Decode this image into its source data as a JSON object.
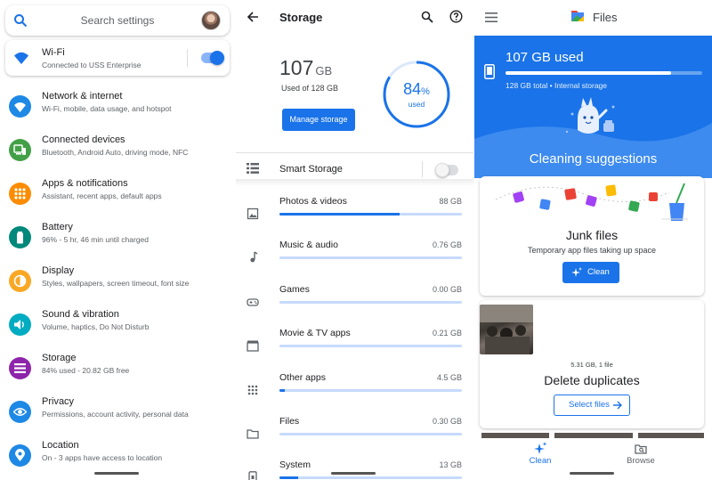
{
  "settings": {
    "search_placeholder": "Search settings",
    "wifi": {
      "title": "Wi-Fi",
      "subtitle": "Connected to USS Enterprise",
      "enabled": true
    },
    "items": [
      {
        "title": "Network & internet",
        "subtitle": "Wi-Fi, mobile, data usage, and hotspot",
        "icon": "wifi-icon",
        "color": "#1e88e5"
      },
      {
        "title": "Connected devices",
        "subtitle": "Bluetooth, Android Auto, driving mode, NFC",
        "icon": "devices-icon",
        "color": "#43a047"
      },
      {
        "title": "Apps & notifications",
        "subtitle": "Assistant, recent apps, default apps",
        "icon": "apps-icon",
        "color": "#fb8c00"
      },
      {
        "title": "Battery",
        "subtitle": "96% - 5 hr, 46 min until charged",
        "icon": "battery-icon",
        "color": "#00897b"
      },
      {
        "title": "Display",
        "subtitle": "Styles, wallpapers, screen timeout, font size",
        "icon": "display-icon",
        "color": "#f9a825"
      },
      {
        "title": "Sound & vibration",
        "subtitle": "Volume, haptics, Do Not Disturb",
        "icon": "volume-icon",
        "color": "#00acc1"
      },
      {
        "title": "Storage",
        "subtitle": "84% used - 20.82 GB free",
        "icon": "storage-icon",
        "color": "#8e24aa"
      },
      {
        "title": "Privacy",
        "subtitle": "Permissions, account activity, personal data",
        "icon": "eye-icon",
        "color": "#1e88e5"
      },
      {
        "title": "Location",
        "subtitle": "On - 3 apps have access to location",
        "icon": "location-icon",
        "color": "#1e88e5"
      }
    ]
  },
  "storage": {
    "title": "Storage",
    "used_value": "107",
    "used_unit": "GB",
    "used_of": "Used of 128 GB",
    "manage_label": "Manage storage",
    "percent_value": "84",
    "percent_sign": "%",
    "percent_fraction": 0.84,
    "used_label": "used",
    "smart_storage_label": "Smart Storage",
    "smart_storage_enabled": false,
    "categories": [
      {
        "label": "Photos & videos",
        "size": "88 GB",
        "fraction": 0.66,
        "icon": "photo-icon"
      },
      {
        "label": "Music & audio",
        "size": "0.76 GB",
        "fraction": 0.0,
        "icon": "music-icon"
      },
      {
        "label": "Games",
        "size": "0.00 GB",
        "fraction": 0.0,
        "icon": "gamepad-icon"
      },
      {
        "label": "Movie & TV apps",
        "size": "0.21 GB",
        "fraction": 0.0,
        "icon": "movie-icon"
      },
      {
        "label": "Other apps",
        "size": "4.5 GB",
        "fraction": 0.03,
        "icon": "grid-icon"
      },
      {
        "label": "Files",
        "size": "0.30 GB",
        "fraction": 0.0,
        "icon": "folder-icon"
      },
      {
        "label": "System",
        "size": "13 GB",
        "fraction": 0.1,
        "icon": "system-icon"
      }
    ]
  },
  "files": {
    "app_title": "Files",
    "used": "107 GB used",
    "used_fraction": 0.84,
    "total_line": "128 GB total • Internal storage",
    "cleaning_title": "Cleaning suggestions",
    "junk": {
      "title": "Junk files",
      "subtitle": "Temporary app files taking up space",
      "button": "Clean"
    },
    "duplicates": {
      "size": "5.31 GB, 1 file",
      "title": "Delete duplicates",
      "button": "Select files"
    },
    "nav": {
      "clean": "Clean",
      "browse": "Browse"
    },
    "colors": {
      "primary": "#1a73e8"
    }
  }
}
